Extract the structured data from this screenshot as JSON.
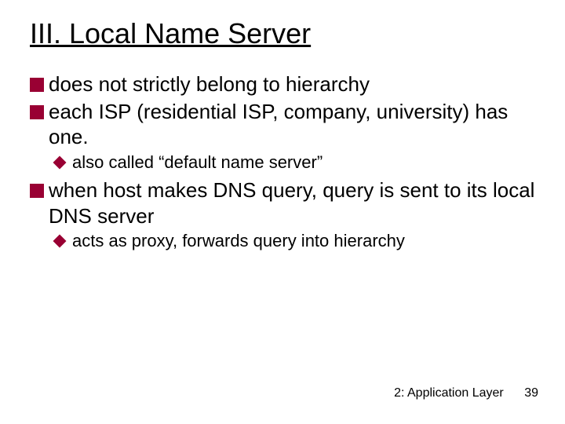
{
  "title": "III. Local Name Server",
  "bullets": {
    "b1": "does not strictly belong to hierarchy",
    "b2": "each ISP (residential ISP, company, university) has one.",
    "b2a": "also called “default name server”",
    "b3": "when host makes DNS query, query is sent to its local DNS server",
    "b3a": "acts as proxy, forwards query into hierarchy"
  },
  "footer": {
    "chapter": "2: Application Layer",
    "page": "39"
  }
}
